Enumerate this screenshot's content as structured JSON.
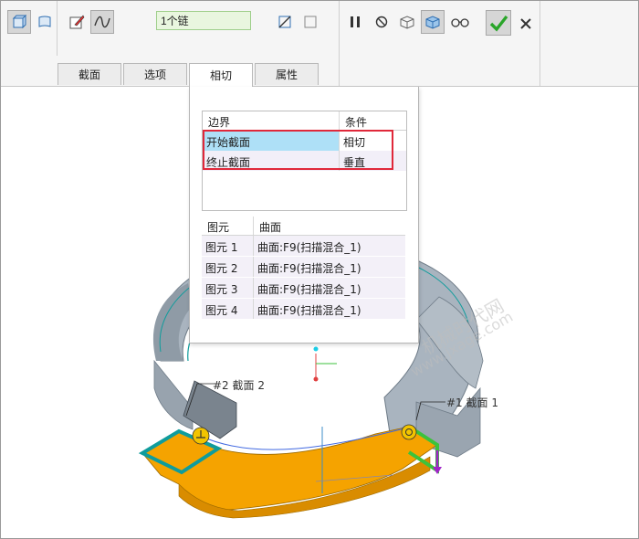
{
  "toolbar": {
    "chain_value": "1个链"
  },
  "tabs": [
    {
      "label": "截面",
      "active": false
    },
    {
      "label": "选项",
      "active": false
    },
    {
      "label": "相切",
      "active": true
    },
    {
      "label": "属性",
      "active": false
    }
  ],
  "boundary_table": {
    "col_boundary": "边界",
    "col_condition": "条件",
    "rows": [
      {
        "boundary": "开始截面",
        "condition": "相切"
      },
      {
        "boundary": "终止截面",
        "condition": "垂直"
      }
    ]
  },
  "entity_table": {
    "col_entity": "图元",
    "col_surface": "曲面",
    "rows": [
      {
        "entity": "图元 1",
        "surface": "曲面:F9(扫描混合_1)"
      },
      {
        "entity": "图元 2",
        "surface": "曲面:F9(扫描混合_1)"
      },
      {
        "entity": "图元 3",
        "surface": "曲面:F9(扫描混合_1)"
      },
      {
        "entity": "图元 4",
        "surface": "曲面:F9(扫描混合_1)"
      }
    ]
  },
  "annotations": {
    "sec2_label": "#2 截面 2",
    "sec1_label": "#1 截面 1"
  },
  "watermark": {
    "line1": "机械时代网",
    "line2": "www.jxage.com"
  },
  "colors": {
    "orange_face": "#f5a300",
    "teal_edge": "#0f9c9c",
    "green_edge": "#3cc23c",
    "gray_body": "#a9b4bf",
    "confirm_green": "#2aa52a",
    "selection_blue": "#aee0f7",
    "highlight_red": "#e0283a"
  }
}
